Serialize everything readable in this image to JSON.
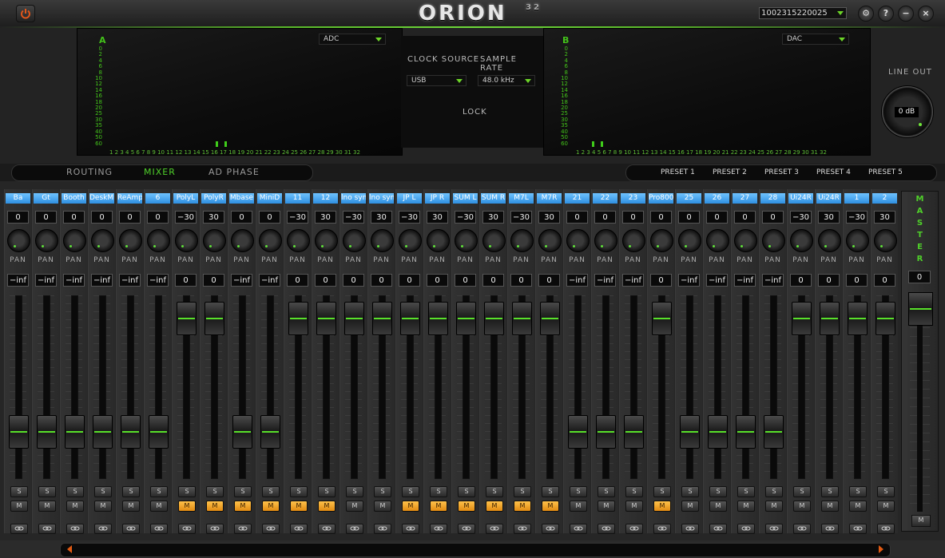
{
  "app": {
    "title": "ORION",
    "title_sup": "32",
    "serial": "1002315220025"
  },
  "titlebar_icons": [
    "settings-icon",
    "help-icon",
    "minimize-icon",
    "close-icon"
  ],
  "meters": {
    "a_label": "A",
    "b_label": "B",
    "adc_select": "ADC",
    "dac_select": "DAC",
    "scale": [
      "0",
      "2",
      "4",
      "6",
      "8",
      "10",
      "12",
      "14",
      "16",
      "18",
      "20",
      "25",
      "30",
      "35",
      "40",
      "50",
      "60"
    ],
    "channel_numbers": "1 2 3 4 5 6 7 8 9 10 11 12 13 14 15 16 17 18 19 20 21 22 23 24 25 26 27 28 29 30 31 32"
  },
  "clock": {
    "clock_source_label": "CLOCK SOURCE",
    "sample_rate_label": "SAMPLE RATE",
    "clock_source_value": "USB",
    "sample_rate_value": "48.0 kHz",
    "lock_label": "LOCK"
  },
  "lineout": {
    "label": "LINE OUT",
    "value": "0 dB"
  },
  "tabs": [
    {
      "label": "ROUTING",
      "active": false
    },
    {
      "label": "MIXER",
      "active": true
    },
    {
      "label": "AD PHASE",
      "active": false
    }
  ],
  "presets": [
    "PRESET 1",
    "PRESET 2",
    "PRESET 3",
    "PRESET 4",
    "PRESET 5"
  ],
  "channels": [
    {
      "name": "Ba",
      "pan": "0",
      "gain": "−inf",
      "fader": 0.2,
      "mute": false
    },
    {
      "name": "Gt",
      "pan": "0",
      "gain": "−inf",
      "fader": 0.2,
      "mute": false
    },
    {
      "name": "Booth",
      "pan": "0",
      "gain": "−inf",
      "fader": 0.2,
      "mute": false
    },
    {
      "name": "DeskMic",
      "pan": "0",
      "gain": "−inf",
      "fader": 0.2,
      "mute": false
    },
    {
      "name": "ReAmp",
      "pan": "0",
      "gain": "−inf",
      "fader": 0.2,
      "mute": false
    },
    {
      "name": "6",
      "pan": "0",
      "gain": "−inf",
      "fader": 0.2,
      "mute": false
    },
    {
      "name": "PolyL",
      "pan": "−30",
      "gain": "0",
      "fader": 0.96,
      "mute": true
    },
    {
      "name": "PolyR",
      "pan": "30",
      "gain": "0",
      "fader": 0.96,
      "mute": true
    },
    {
      "name": "Mbase",
      "pan": "0",
      "gain": "−inf",
      "fader": 0.2,
      "mute": true
    },
    {
      "name": "MiniD",
      "pan": "0",
      "gain": "−inf",
      "fader": 0.2,
      "mute": true
    },
    {
      "name": "11",
      "pan": "−30",
      "gain": "0",
      "fader": 0.96,
      "mute": true
    },
    {
      "name": "12",
      "pan": "30",
      "gain": "0",
      "fader": 0.96,
      "mute": true
    },
    {
      "name": "lno synt",
      "pan": "−30",
      "gain": "0",
      "fader": 0.96,
      "mute": false
    },
    {
      "name": "lno synt",
      "pan": "30",
      "gain": "0",
      "fader": 0.96,
      "mute": false
    },
    {
      "name": "JP L",
      "pan": "−30",
      "gain": "0",
      "fader": 0.96,
      "mute": true
    },
    {
      "name": "JP R",
      "pan": "30",
      "gain": "0",
      "fader": 0.96,
      "mute": true
    },
    {
      "name": "SUM L",
      "pan": "−30",
      "gain": "0",
      "fader": 0.96,
      "mute": true
    },
    {
      "name": "SUM R",
      "pan": "30",
      "gain": "0",
      "fader": 0.96,
      "mute": true
    },
    {
      "name": "M7L",
      "pan": "−30",
      "gain": "0",
      "fader": 0.96,
      "mute": true
    },
    {
      "name": "M7R",
      "pan": "30",
      "gain": "0",
      "fader": 0.96,
      "mute": true
    },
    {
      "name": "21",
      "pan": "0",
      "gain": "−inf",
      "fader": 0.2,
      "mute": false
    },
    {
      "name": "22",
      "pan": "0",
      "gain": "−inf",
      "fader": 0.2,
      "mute": false
    },
    {
      "name": "23",
      "pan": "0",
      "gain": "−inf",
      "fader": 0.2,
      "mute": false
    },
    {
      "name": "Pro800",
      "pan": "0",
      "gain": "0",
      "fader": 0.96,
      "mute": true
    },
    {
      "name": "25",
      "pan": "0",
      "gain": "−inf",
      "fader": 0.2,
      "mute": false
    },
    {
      "name": "26",
      "pan": "0",
      "gain": "−inf",
      "fader": 0.2,
      "mute": false
    },
    {
      "name": "27",
      "pan": "0",
      "gain": "−inf",
      "fader": 0.2,
      "mute": false
    },
    {
      "name": "28",
      "pan": "0",
      "gain": "−inf",
      "fader": 0.2,
      "mute": false
    },
    {
      "name": "Ui24R",
      "pan": "−30",
      "gain": "0",
      "fader": 0.96,
      "mute": false
    },
    {
      "name": "Ui24R",
      "pan": "30",
      "gain": "0",
      "fader": 0.96,
      "mute": false
    },
    {
      "name": "1",
      "pan": "−30",
      "gain": "0",
      "fader": 0.96,
      "mute": false
    },
    {
      "name": "2",
      "pan": "30",
      "gain": "0",
      "fader": 0.96,
      "mute": false
    }
  ],
  "strip_labels": {
    "pan": "PAN",
    "solo": "S",
    "mute": "M"
  },
  "master": {
    "label": "MASTER",
    "value": "0",
    "mute": "M"
  },
  "colors": {
    "accent_green": "#4fd02a",
    "channel_name_blue": "#2f8fe0",
    "mute_on_orange": "#e08a12"
  }
}
